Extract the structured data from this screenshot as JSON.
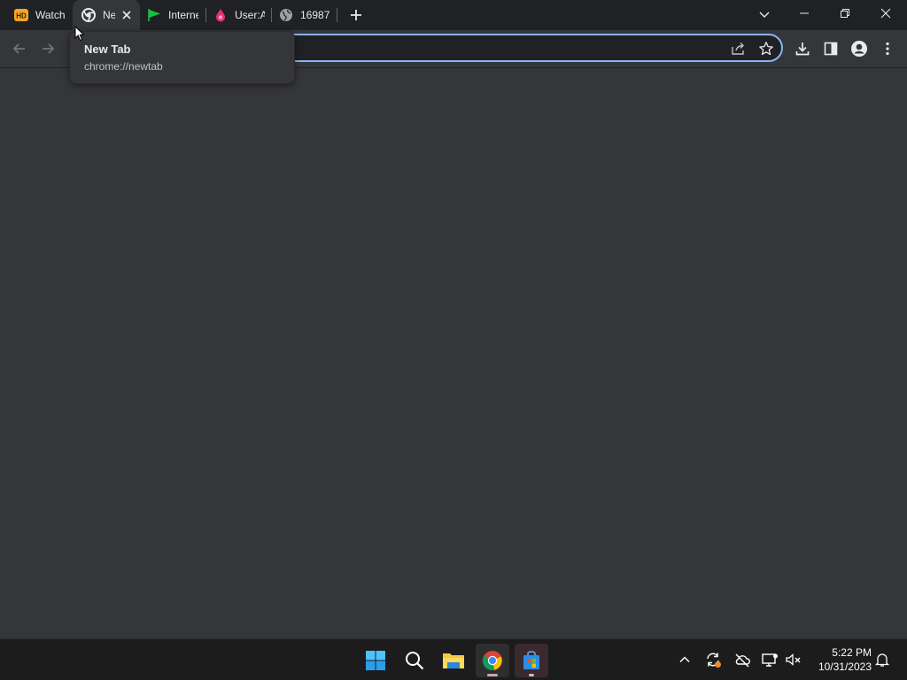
{
  "browser": {
    "tabs": [
      {
        "title": "Watch",
        "icon": "hd-icon"
      },
      {
        "title": "Ne",
        "icon": "chrome-icon",
        "active": true
      },
      {
        "title": "Interne",
        "icon": "green-flag-icon"
      },
      {
        "title": "User:A",
        "icon": "pink-drop-icon"
      },
      {
        "title": "16987",
        "icon": "globe-icon"
      }
    ],
    "new_tab_label": "+",
    "omnibox": {
      "value": "",
      "placeholder": ""
    },
    "tooltip": {
      "title": "New Tab",
      "url": "chrome://newtab"
    }
  },
  "taskbar": {
    "apps": [
      "start-button",
      "search",
      "file-explorer",
      "chrome",
      "microsoft-store"
    ],
    "clock": {
      "time": "5:22 PM",
      "date": "10/31/2023"
    }
  },
  "colors": {
    "tabstrip": "#202124",
    "toolbar": "#35363a",
    "omnibox_border": "#8ab4f8",
    "taskbar": "#1c1c1c"
  }
}
